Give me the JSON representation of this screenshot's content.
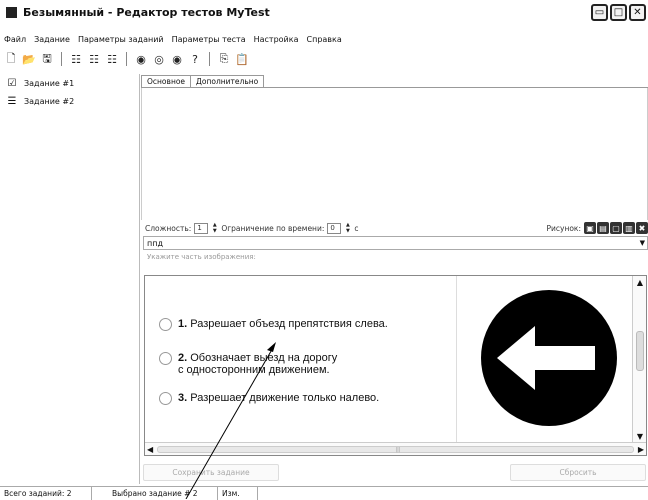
{
  "window": {
    "title": "Безымянный - Редактор тестов MyTest",
    "buttons": [
      "▭",
      "□",
      "✕"
    ]
  },
  "menu": [
    "Файл",
    "Задание",
    "Параметры заданий",
    "Параметры теста",
    "Настройка",
    "Справка"
  ],
  "task_list": [
    {
      "label": "Задание #1",
      "icon": "checkbox-task-icon"
    },
    {
      "label": "Задание #2",
      "icon": "list-task-icon"
    }
  ],
  "tabs": [
    "Основное",
    "Дополнительно"
  ],
  "params": {
    "difficulty_label": "Сложность:",
    "difficulty_value": "1",
    "time_limit_label": "Ограничение по времени:",
    "time_limit_value": "0",
    "time_unit": "с",
    "picture_label": "Рисунок:"
  },
  "select": {
    "value": "ппд"
  },
  "hint": "Укажите часть изображения:",
  "answers": [
    {
      "num": "1.",
      "text": "Разрешает объезд препятствия слева."
    },
    {
      "num": "2.",
      "text": "Обозначает выезд на дорогу",
      "text2": "с односторонним движением."
    },
    {
      "num": "3.",
      "text": "Разрешает движение только налево."
    }
  ],
  "buttons": {
    "save": "Сохранить задание",
    "reset": "Сбросить"
  },
  "status": {
    "total": "Всего заданий: 2",
    "selected": "Выбрано задание # 2",
    "changed": "Изм."
  },
  "colors": {
    "sign_background": "#000000",
    "sign_arrow": "#ffffff"
  }
}
